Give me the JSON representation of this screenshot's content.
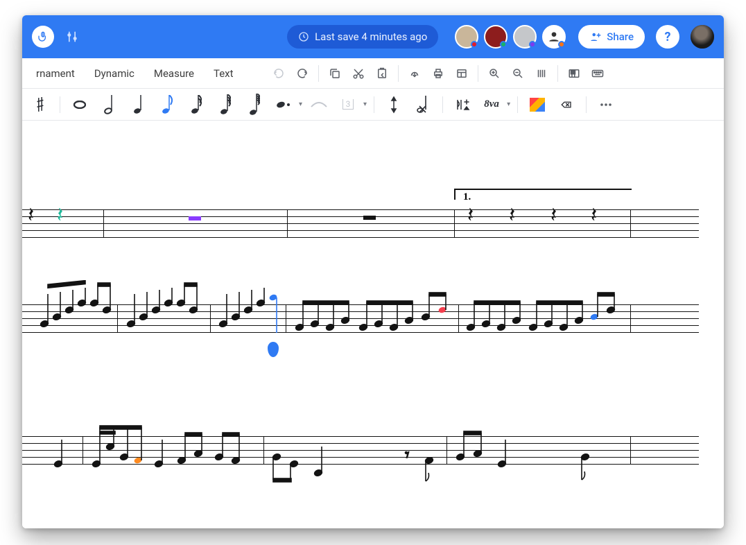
{
  "topbar": {
    "last_save_text": "Last save 4 minutes ago",
    "share_label": "Share",
    "help_label": "?",
    "avatars": [
      {
        "bg": "#c9b69a",
        "dot": "#e11d2a"
      },
      {
        "bg": "#8d1d1d",
        "dot": "#17b26a"
      },
      {
        "bg": "#c5c7ca",
        "dot": "#7c3aed"
      },
      {
        "bg": "#ffffff",
        "dot": "#f97316",
        "icon": true
      }
    ]
  },
  "menubar": {
    "items": [
      "rnament",
      "Dynamic",
      "Measure",
      "Text"
    ]
  },
  "notebar": {
    "ottava_label": "8va"
  },
  "score": {
    "volta_label": "1."
  },
  "colors": {
    "brand": "#2F7AF3",
    "brand_dark": "#1E5BD6"
  }
}
